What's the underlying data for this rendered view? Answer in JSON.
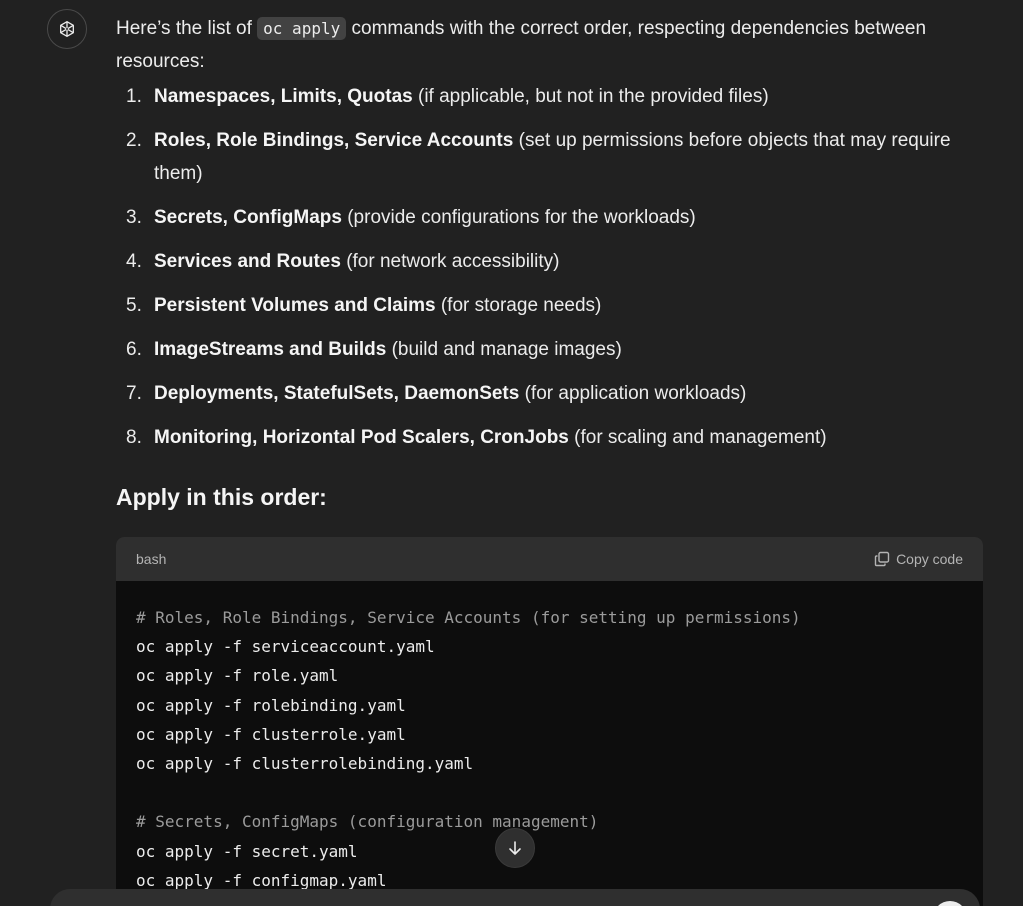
{
  "message": {
    "intro_prefix": "Here’s the list of ",
    "intro_code": "oc apply",
    "intro_suffix": " commands with the correct order, respecting dependencies between resources:",
    "steps": [
      {
        "num": "1.",
        "bold": "Namespaces, Limits, Quotas",
        "rest": " (if applicable, but not in the provided files)"
      },
      {
        "num": "2.",
        "bold": "Roles, Role Bindings, Service Accounts",
        "rest": " (set up permissions before objects that may require them)"
      },
      {
        "num": "3.",
        "bold": "Secrets, ConfigMaps",
        "rest": " (provide configurations for the workloads)"
      },
      {
        "num": "4.",
        "bold": "Services and Routes",
        "rest": " (for network accessibility)"
      },
      {
        "num": "5.",
        "bold": "Persistent Volumes and Claims",
        "rest": " (for storage needs)"
      },
      {
        "num": "6.",
        "bold": "ImageStreams and Builds",
        "rest": " (build and manage images)"
      },
      {
        "num": "7.",
        "bold": "Deployments, StatefulSets, DaemonSets",
        "rest": " (for application workloads)"
      },
      {
        "num": "8.",
        "bold": "Monitoring, Horizontal Pod Scalers, CronJobs",
        "rest": " (for scaling and management)"
      }
    ],
    "section_heading": "Apply in this order:"
  },
  "code_block": {
    "language": "bash",
    "copy_label": "Copy code",
    "lines": [
      "# Roles, Role Bindings, Service Accounts (for setting up permissions)",
      "oc apply -f serviceaccount.yaml",
      "oc apply -f role.yaml",
      "oc apply -f rolebinding.yaml",
      "oc apply -f clusterrole.yaml",
      "oc apply -f clusterrolebinding.yaml",
      "",
      "# Secrets, ConfigMaps (configuration management)",
      "oc apply -f secret.yaml",
      "oc apply -f configmap.yaml"
    ]
  },
  "icons": {
    "avatar": "openai-logo-icon",
    "copy": "copy-icon",
    "scroll": "arrow-down-icon"
  },
  "colors": {
    "background": "#212121",
    "code_background": "#0d0d0d",
    "code_header": "#2f2f2f",
    "comment": "#9b9b9b",
    "text": "#ececec"
  }
}
